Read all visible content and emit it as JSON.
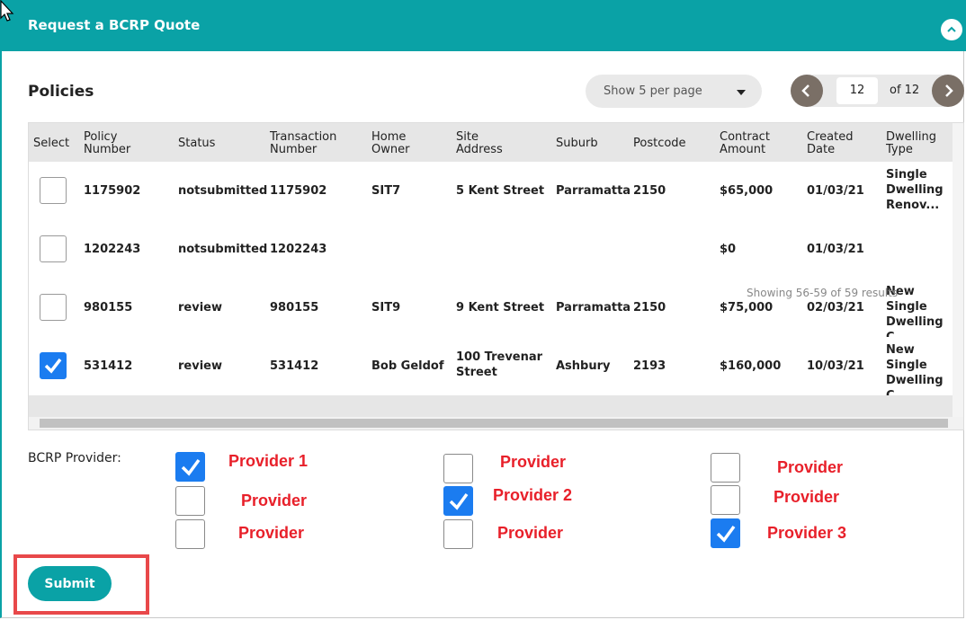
{
  "header": {
    "title": "Request a BCRP Quote",
    "brand_color": "#0aa2a6"
  },
  "policies": {
    "title": "Policies",
    "per_page": "Show 5 per page",
    "pagination": {
      "current_page": "12",
      "of_label": "of 12"
    },
    "columns": [
      "Select",
      "Policy Number",
      "Status",
      "Transaction Number",
      "Home Owner",
      "Site Address",
      "Suburb",
      "Postcode",
      "Contract Amount",
      "Created Date",
      "Dwelling Type"
    ],
    "rows": [
      {
        "selected": false,
        "policy_number": "1175902",
        "status": "notsubmitted",
        "transaction_number": "1175902",
        "home_owner": "SIT7",
        "site_address": "5 Kent Street",
        "suburb": "Parramatta",
        "postcode": "2150",
        "contract_amount": "$65,000",
        "created_date": "01/03/21",
        "dwelling_type": "Single Dwelling Renov..."
      },
      {
        "selected": false,
        "policy_number": "1202243",
        "status": "notsubmitted",
        "transaction_number": "1202243",
        "home_owner": "",
        "site_address": "",
        "suburb": "",
        "postcode": "",
        "contract_amount": "$0",
        "created_date": "01/03/21",
        "dwelling_type": ""
      },
      {
        "selected": false,
        "policy_number": "980155",
        "status": "review",
        "transaction_number": "980155",
        "home_owner": "SIT9",
        "site_address": "9 Kent Street",
        "suburb": "Parramatta",
        "postcode": "2150",
        "contract_amount": "$75,000",
        "created_date": "02/03/21",
        "dwelling_type": "New Single Dwelling C..."
      },
      {
        "selected": true,
        "policy_number": "531412",
        "status": "review",
        "transaction_number": "531412",
        "home_owner": "Bob Geldof",
        "site_address": "100 Trevenar Street",
        "suburb": "Ashbury",
        "postcode": "2193",
        "contract_amount": "$160,000",
        "created_date": "10/03/21",
        "dwelling_type": "New Single Dwelling C..."
      }
    ],
    "showing_text": "Showing 56-59 of 59 results"
  },
  "bcrp": {
    "label": "BCRP Provider:",
    "providers": [
      {
        "label": "Provider 1",
        "checked": true
      },
      {
        "label": "Provider",
        "checked": false
      },
      {
        "label": "Provider",
        "checked": false
      },
      {
        "label": "Provider",
        "checked": false
      },
      {
        "label": "Provider 2",
        "checked": true
      },
      {
        "label": "Provider",
        "checked": false
      },
      {
        "label": "Provider",
        "checked": false
      },
      {
        "label": "Provider",
        "checked": false
      },
      {
        "label": "Provider 3",
        "checked": true
      }
    ]
  },
  "actions": {
    "submit_label": "Submit"
  },
  "colors": {
    "teal": "#0aa2a6",
    "checkbox_blue": "#1b7cf0",
    "provider_red": "#e8202a",
    "highlight_red": "#e8484a"
  }
}
